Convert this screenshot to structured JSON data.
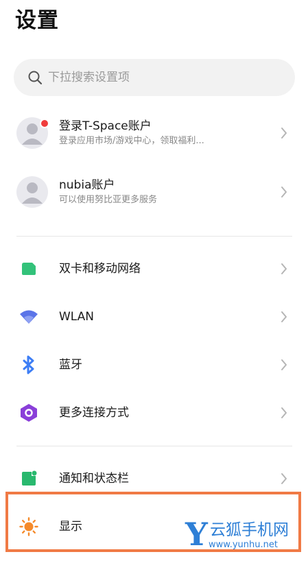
{
  "header": {
    "title": "设置"
  },
  "search": {
    "placeholder": "下拉搜索设置项"
  },
  "accounts": [
    {
      "title": "登录T-Space账户",
      "subtitle": "登录应用市场/游戏中心，领取福利..."
    },
    {
      "title": "nubia账户",
      "subtitle": "可以使用努比亚更多服务"
    }
  ],
  "connectivity": [
    {
      "label": "双卡和移动网络",
      "icon": "sim-card-icon"
    },
    {
      "label": "WLAN",
      "icon": "wifi-icon"
    },
    {
      "label": "蓝牙",
      "icon": "bluetooth-icon"
    },
    {
      "label": "更多连接方式",
      "icon": "connection-hex-icon"
    }
  ],
  "system": [
    {
      "label": "通知和状态栏",
      "icon": "notification-icon"
    },
    {
      "label": "显示",
      "icon": "sun-icon"
    }
  ],
  "watermark": {
    "letter": "Y",
    "name": "云狐手机网",
    "url": "www.yunhu.net"
  },
  "colors": {
    "sim": "#33c27a",
    "wifi": "#5b74e8",
    "bluetooth": "#3d7ef5",
    "hex": "#8a3fd9",
    "notify": "#29b86e",
    "sun": "#f58a2a",
    "badge": "#f03c3c",
    "highlight": "#f07a45",
    "watermark": "#2e7fd6"
  }
}
